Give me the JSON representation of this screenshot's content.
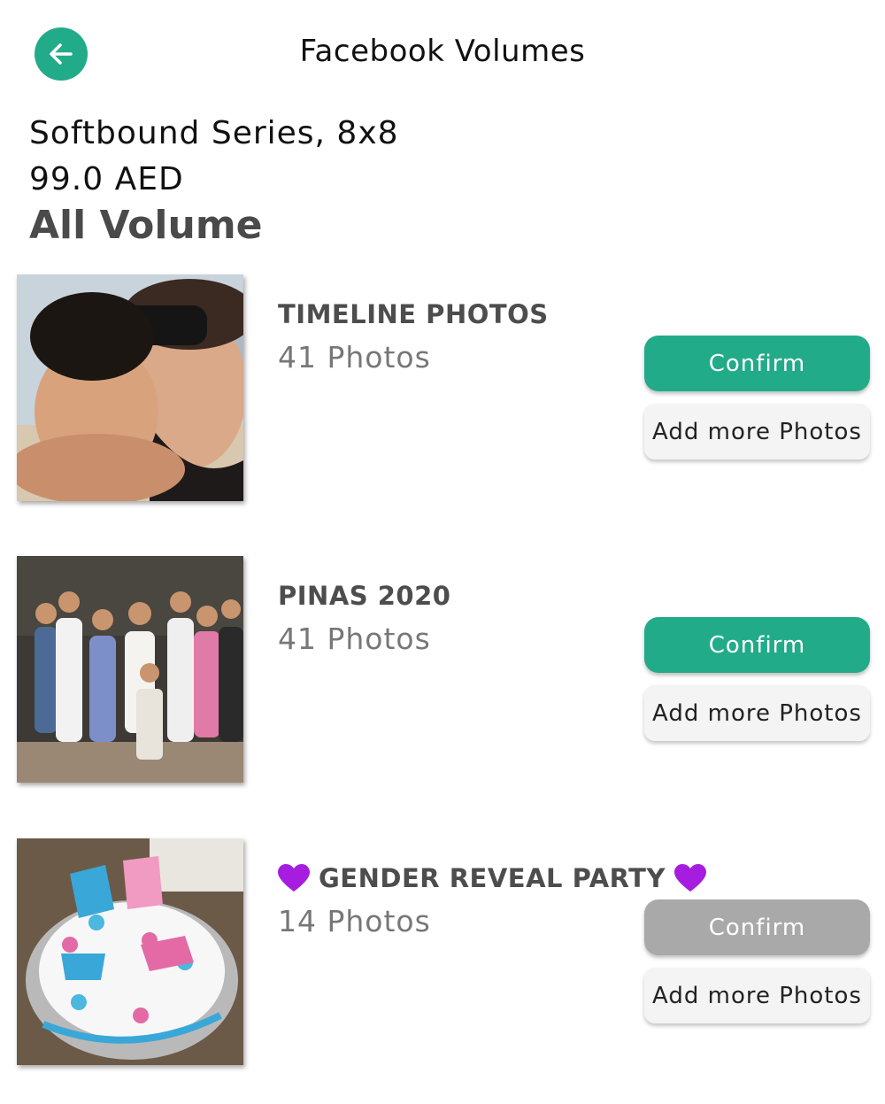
{
  "header": {
    "title": "Facebook Volumes",
    "back_icon": "arrow-left-icon"
  },
  "product": {
    "name": "Softbound Series, 8x8",
    "price": "99.0 AED"
  },
  "section_title": "All Volume",
  "colors": {
    "accent": "#22ab89",
    "disabled": "#a9a9a9",
    "heart": "#a61de0"
  },
  "volumes": [
    {
      "title": "TIMELINE PHOTOS",
      "count": "41 Photos",
      "confirm_label": "Confirm",
      "confirm_enabled": true,
      "add_label": "Add more Photos",
      "thumbnail": "selfie-photo"
    },
    {
      "title": "PINAS 2020",
      "count": "41 Photos",
      "confirm_label": "Confirm",
      "confirm_enabled": true,
      "add_label": "Add more Photos",
      "thumbnail": "group-photo"
    },
    {
      "title": "GENDER REVEAL PARTY",
      "title_emoji": "purple-heart-icon",
      "count": "14 Photos",
      "confirm_label": "Confirm",
      "confirm_enabled": false,
      "add_label": "Add more Photos",
      "thumbnail": "cake-photo"
    }
  ]
}
